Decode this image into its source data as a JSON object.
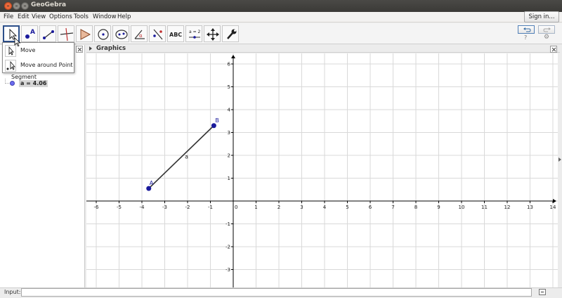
{
  "window": {
    "title": "GeoGebra"
  },
  "menu": {
    "items": [
      "File",
      "Edit",
      "View",
      "Options",
      "Tools",
      "Window",
      "Help"
    ],
    "signin_label": "Sign in..."
  },
  "toolbar": {
    "tools": [
      {
        "name": "move-tool"
      },
      {
        "name": "point-tool",
        "glyph": "A"
      },
      {
        "name": "line-tool"
      },
      {
        "name": "perpendicular-tool"
      },
      {
        "name": "polygon-tool"
      },
      {
        "name": "circle-tool"
      },
      {
        "name": "ellipse-tool"
      },
      {
        "name": "angle-tool",
        "glyph": "α"
      },
      {
        "name": "reflect-tool"
      },
      {
        "name": "text-tool",
        "glyph": "ABC"
      },
      {
        "name": "slider-tool",
        "glyph": "a = 2"
      },
      {
        "name": "move-graphics-tool"
      },
      {
        "name": "properties-tool"
      }
    ],
    "help_icon": "?",
    "settings_icon": "⚙"
  },
  "dropdown": {
    "items": [
      {
        "label": "Move"
      },
      {
        "label": "Move around Point"
      }
    ]
  },
  "algebra": {
    "category": "Segment",
    "item": "a = 4.06"
  },
  "graphics": {
    "title": "Graphics",
    "x_ticks": [
      -6,
      -5,
      -4,
      -3,
      -2,
      -1,
      0,
      1,
      2,
      3,
      4,
      5,
      6,
      7,
      8,
      9,
      10,
      11,
      12,
      13,
      14
    ],
    "y_ticks": [
      -3,
      -2,
      -1,
      0,
      1,
      2,
      3,
      4,
      5,
      6
    ],
    "points": [
      {
        "label": "A",
        "x": -3.7,
        "y": 0.55
      },
      {
        "label": "B",
        "x": -0.85,
        "y": 3.3
      }
    ],
    "segment": {
      "label": "a",
      "from": "A",
      "to": "B"
    },
    "colors": {
      "point": "#1a1a9c",
      "segment": "#333333",
      "grid": "#d9d9d9",
      "axis": "#000000"
    }
  },
  "input": {
    "label": "Input:",
    "value": ""
  }
}
